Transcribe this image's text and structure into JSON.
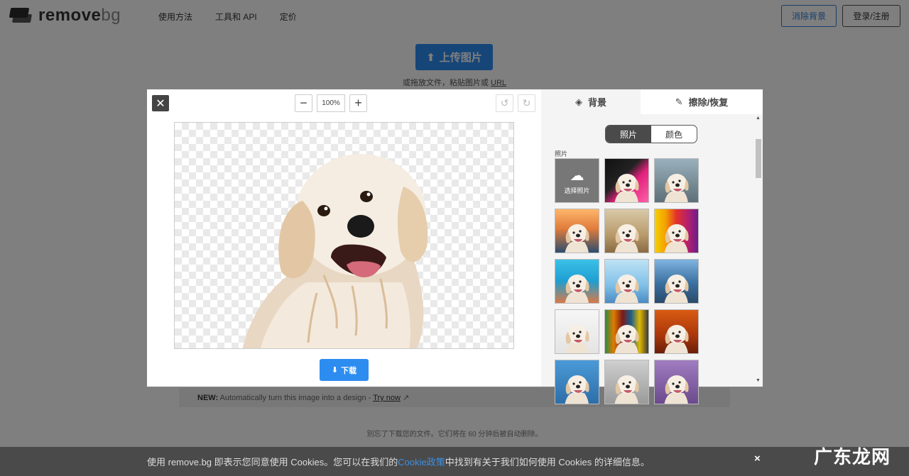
{
  "header": {
    "logo_main": "remove",
    "logo_suffix": "bg",
    "nav": [
      "使用方法",
      "工具和 API",
      "定价"
    ],
    "remove_bg_btn": "消除背景",
    "login_btn": "登录/注册"
  },
  "upload": {
    "button_label": "上传图片",
    "hint_prefix": "或拖放文件，粘贴图片或",
    "hint_link": "URL"
  },
  "new_bar": {
    "label": "NEW:",
    "text": "Automatically turn this image into a design -",
    "link": "Try now"
  },
  "expire_note": "别忘了下载您的文件。它们将在 60 分钟后被自动删除。",
  "cookie": {
    "prefix": "使用 remove.bg 即表示您同意使用 Cookies。您可以在我们的",
    "link": "Cookie政策",
    "suffix": "中找到有关于我们如何使用 Cookies 的详细信息。",
    "close": "×"
  },
  "watermark": "广东龙网",
  "modal": {
    "close": "✕",
    "zoom_out": "−",
    "zoom_value": "100%",
    "zoom_in": "+",
    "undo": "↺",
    "redo": "↻",
    "download": "下载"
  },
  "panel": {
    "tab_background": "背景",
    "tab_erase": "擦除/恢复",
    "seg_photo": "照片",
    "seg_color": "颜色",
    "grid_label": "照片",
    "upload_tile": "选择照片",
    "thumbs": [
      {
        "name": "pink-dots",
        "bg": "linear-gradient(135deg,#111 0%,#222 40%,#e0207a 60%,#ff5fa8 100%)"
      },
      {
        "name": "city-fog",
        "bg": "linear-gradient(180deg,#9ab0bd 0%,#7b9099 50%,#5e6f78 100%)"
      },
      {
        "name": "sunset-sea",
        "bg": "linear-gradient(180deg,#ffb56b 0%,#e07c3c 45%,#2c4d6e 100%)"
      },
      {
        "name": "cafe-interior",
        "bg": "linear-gradient(180deg,#d9c9a8 0%,#b89a6b 60%,#8a6a42 100%)"
      },
      {
        "name": "rainbow-stripes",
        "bg": "linear-gradient(90deg,#f4d000 0%,#f4a000 25%,#e3322b 50%,#b8206a 75%,#6c1d8c 100%)"
      },
      {
        "name": "beach-chairs",
        "bg": "linear-gradient(180deg,#3bc1e8 0%,#1f9ed1 50%,#d87a48 100%)"
      },
      {
        "name": "sky-tower",
        "bg": "linear-gradient(180deg,#bfe2f5 0%,#7fc0e8 60%,#4a8bc4 100%)"
      },
      {
        "name": "mountain-lake",
        "bg": "linear-gradient(180deg,#7fb3e0 0%,#3a6f9f 55%,#2b4a6a 100%)"
      },
      {
        "name": "white-studio",
        "bg": "linear-gradient(180deg,#f6f6f6 0%,#e4e4e4 100%)"
      },
      {
        "name": "color-bars",
        "bg": "linear-gradient(90deg,#2b8a3e 0%,#e07b00 20%,#7a1a1a 40%,#1a5e8a 60%,#e0b800 80%,#3a3a3a 100%)"
      },
      {
        "name": "autumn-leaves",
        "bg": "linear-gradient(180deg,#d95b12 0%,#a8360b 60%,#6a200a 100%)"
      },
      {
        "name": "skyline-blue",
        "bg": "linear-gradient(180deg,#4a9ad8 0%,#2d6ea8 100%)"
      },
      {
        "name": "grey-arches",
        "bg": "linear-gradient(180deg,#cfcfcf 0%,#9a9a9a 100%)"
      },
      {
        "name": "purple-haze",
        "bg": "linear-gradient(180deg,#a07cc0 0%,#6a4a8c 100%)"
      }
    ]
  },
  "colors": {
    "accent_blue": "#2d8cf0",
    "dark_grey": "#444444"
  }
}
